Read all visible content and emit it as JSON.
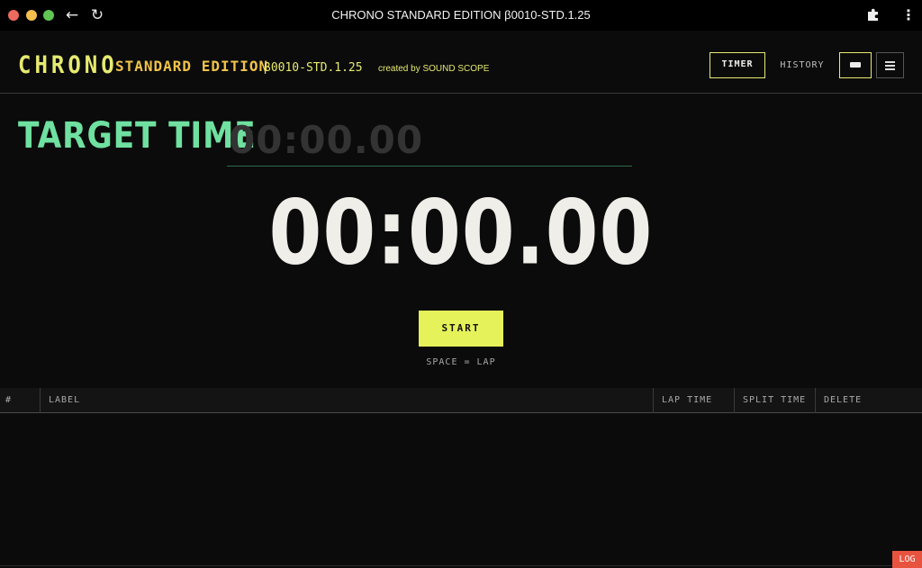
{
  "window": {
    "title": "CHRONO STANDARD EDITION β0010-STD.1.25",
    "back_glyph": "←",
    "reload_glyph": "↻",
    "menu_glyph": "⋮"
  },
  "header": {
    "brand": "CHRONO",
    "edition": "STANDARD EDITION",
    "version": "β0010-STD.1.25",
    "credit": "created by SOUND SCOPE",
    "nav": {
      "timer": "TIMER",
      "history": "HISTORY"
    }
  },
  "target": {
    "label": "TARGET TIME",
    "placeholder": "00:00.00",
    "value": ""
  },
  "clock": {
    "display": "00:00.00"
  },
  "controls": {
    "start_label": "START",
    "hint": "SPACE = LAP"
  },
  "laps": {
    "columns": [
      "#",
      "LABEL",
      "LAP TIME",
      "SPLIT TIME",
      "DELETE"
    ],
    "rows": []
  },
  "footer": {
    "log_label": "LOG"
  },
  "colors": {
    "accent_yellow": "#e6ea70",
    "edition_gold": "#f0c44a",
    "target_green": "#6fe0a0",
    "start_button": "#e6f25a",
    "log_button": "#e8533f",
    "background": "#0b0b0b"
  },
  "icons": {
    "extensions": "puzzle-icon",
    "keyboard": "keyboard-icon",
    "menu": "hamburger-icon"
  }
}
